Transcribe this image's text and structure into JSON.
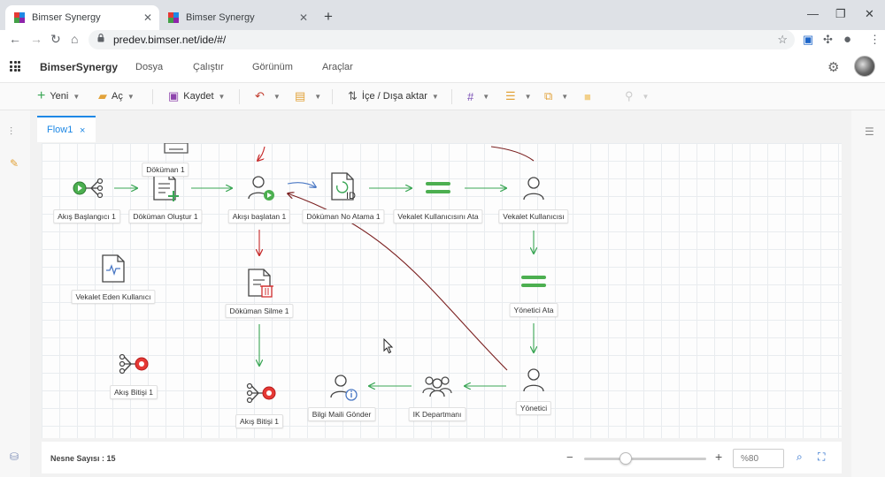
{
  "browser": {
    "tabs": [
      {
        "title": "Bimser Synergy",
        "active": true
      },
      {
        "title": "Bimser Synergy",
        "active": false
      }
    ],
    "url": "predev.bimser.net/ide/#/"
  },
  "app": {
    "brand": "BimserSynergy",
    "menu": [
      "Dosya",
      "Çalıştır",
      "Görünüm",
      "Araçlar"
    ]
  },
  "toolbar": {
    "new_label": "Yeni",
    "open_label": "Aç",
    "save_label": "Kaydet",
    "import_export_label": "İçe / Dışa aktar"
  },
  "editor": {
    "tab_label": "Flow1",
    "tab_close": "×"
  },
  "diagram": {
    "nodes": [
      {
        "id": "start1",
        "label": "Akış Başlangıcı 1"
      },
      {
        "id": "doc_create",
        "label": "Döküman Oluştur 1"
      },
      {
        "id": "doc1",
        "label": "Döküman 1"
      },
      {
        "id": "flow_started",
        "label": "Akışı başlatan 1"
      },
      {
        "id": "doc_no",
        "label": "Döküman No Atama 1"
      },
      {
        "id": "proxy_assign",
        "label": "Vekalet Kullanıcısını Ata"
      },
      {
        "id": "proxy_user",
        "label": "Vekalet Kullanıcısı"
      },
      {
        "id": "delegator",
        "label": "Vekalet Eden Kullanıcı"
      },
      {
        "id": "doc_delete",
        "label": "Döküman Silme 1"
      },
      {
        "id": "manager_assign",
        "label": "Yönetici Ata"
      },
      {
        "id": "end1",
        "label": "Akış Bitişi 1"
      },
      {
        "id": "end2",
        "label": "Akış Bitişi 1"
      },
      {
        "id": "info_mail",
        "label": "Bilgi Maili Gönder"
      },
      {
        "id": "hr",
        "label": "IK Departmanı"
      },
      {
        "id": "manager",
        "label": "Yönetici"
      }
    ]
  },
  "status": {
    "object_count": "Nesne Sayısı : 15",
    "zoom": "%80"
  },
  "colors": {
    "accent": "#1e88e5",
    "flow_green": "#3aa655",
    "flow_red": "#c62828",
    "link_dark_red": "#7a1f1f"
  }
}
